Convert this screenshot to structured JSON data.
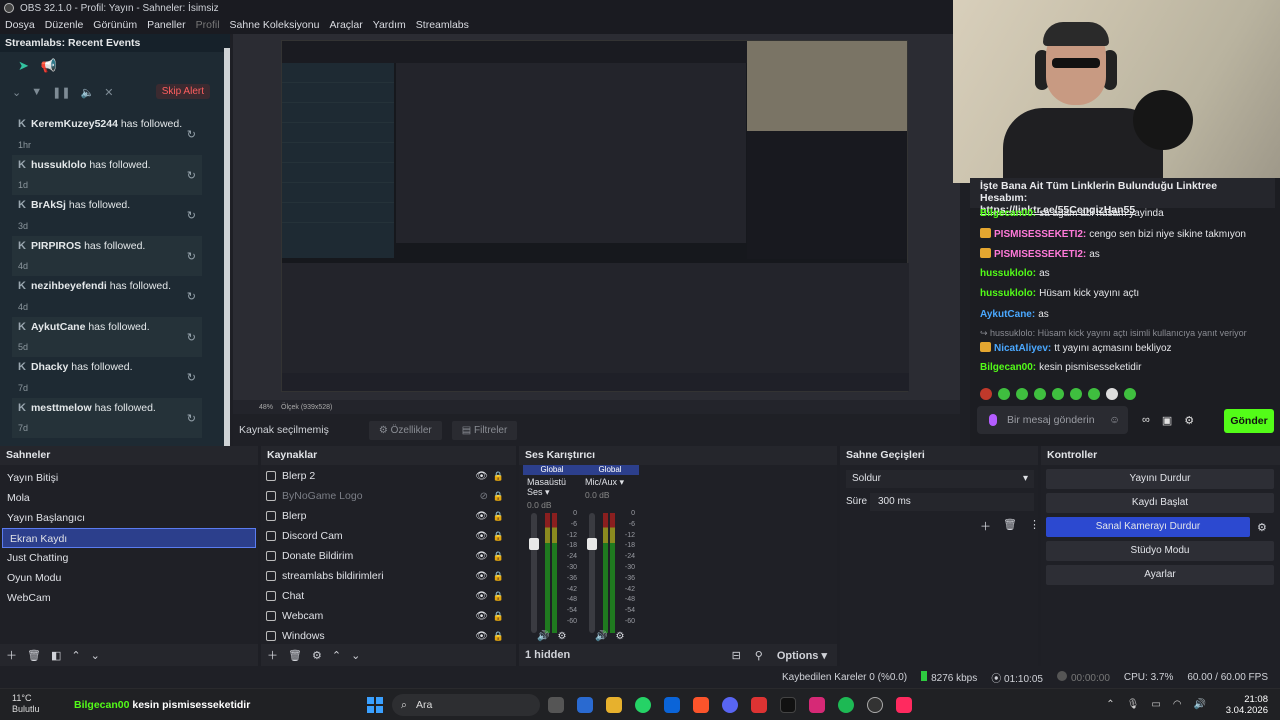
{
  "window": {
    "title": "OBS 32.1.0 - Profil: Yayın - Sahneler: İsimsiz"
  },
  "menu": [
    "Dosya",
    "Düzenle",
    "Görünüm",
    "Paneller",
    "Profil",
    "Sahne Koleksiyonu",
    "Araçlar",
    "Yardım",
    "Streamlabs"
  ],
  "events": {
    "title": "Streamlabs: Recent Events",
    "skip_label": "Skip Alert",
    "items": [
      {
        "name": "KeremKuzey5244",
        "action": "has followed.",
        "when": "1hr"
      },
      {
        "name": "hussuklolo",
        "action": "has followed.",
        "when": "1d"
      },
      {
        "name": "BrAkSj",
        "action": "has followed.",
        "when": "3d"
      },
      {
        "name": "PIRPIROS",
        "action": "has followed.",
        "when": "4d"
      },
      {
        "name": "nezihbeyefendi",
        "action": "has followed.",
        "when": "4d"
      },
      {
        "name": "AykutCane",
        "action": "has followed.",
        "when": "5d"
      },
      {
        "name": "Dhacky",
        "action": "has followed.",
        "when": "7d"
      },
      {
        "name": "mesttmelow",
        "action": "has followed.",
        "when": "7d"
      }
    ]
  },
  "preview": {
    "zoom": "48%",
    "scale_label": "Ölçek (939x528)"
  },
  "source_bar": {
    "label": "Kaynak seçilmemiş",
    "props": "Özellikler",
    "filters": "Filtreler"
  },
  "chat": {
    "pinned_text": "İşte Bana Ait Tüm Linklerin Bulunduğu Linktree Hesabım:",
    "pinned_link": "https://linktr.ee/55CengizHan55",
    "lines": [
      {
        "user": "Bilgecan00:",
        "text": "sa agam abi husam yayinda",
        "color": "#53fc18",
        "badge": false
      },
      {
        "user": "PISMISESSEKETI2:",
        "text": "cengo sen bizi niye sikine takmıyon",
        "color": "#ff7ad9",
        "badge": true
      },
      {
        "user": "PISMISESSEKETI2:",
        "text": "as",
        "color": "#ff7ad9",
        "badge": true
      },
      {
        "user": "hussuklolo:",
        "text": "as",
        "color": "#53fc18",
        "badge": false
      },
      {
        "user": "hussuklolo:",
        "text": "Hüsam kick yayını açtı",
        "color": "#53fc18",
        "badge": false
      },
      {
        "user": "AykutCane:",
        "text": "as",
        "color": "#4aa8ff",
        "badge": false
      },
      {
        "user": "",
        "text": "↪ hussuklolo: Hüsam kick yayını açtı isimli kullanıcıya yanıt veriyor",
        "color": "#8a8c93",
        "badge": false
      },
      {
        "user": "NicatAliyev:",
        "text": "tt yayını açmasını bekliyoz",
        "color": "#4aa8ff",
        "badge": true
      },
      {
        "user": "Bilgecan00:",
        "text": "kesin pismisesseketidir",
        "color": "#53fc18",
        "badge": false
      }
    ],
    "input_placeholder": "Bir mesaj gönderin",
    "send_label": "Gönder"
  },
  "scenes": {
    "title": "Sahneler",
    "items": [
      "Yayın Bitişi",
      "Mola",
      "Yayın Başlangıcı",
      "Ekran Kaydı",
      "Just Chatting",
      "Oyun Modu",
      "WebCam"
    ],
    "selected": 3
  },
  "sources": {
    "title": "Kaynaklar",
    "items": [
      {
        "name": "Blerp 2",
        "dim": false
      },
      {
        "name": "ByNoGame Logo",
        "dim": true
      },
      {
        "name": "Blerp",
        "dim": false
      },
      {
        "name": "Discord Cam",
        "dim": false
      },
      {
        "name": "Donate Bildirim",
        "dim": false
      },
      {
        "name": "streamlabs bildirimleri",
        "dim": false
      },
      {
        "name": "Chat",
        "dim": false
      },
      {
        "name": "Webcam",
        "dim": false
      },
      {
        "name": "Windows",
        "dim": false
      }
    ]
  },
  "mixer": {
    "title": "Ses Karıştırıcı",
    "channels": [
      {
        "tag": "Global",
        "name": "Masaüstü Ses",
        "db": "0.0 dB",
        "level": 0.75
      },
      {
        "tag": "Global",
        "name": "Mic/Aux",
        "db": "0.0 dB",
        "level": 0.75
      }
    ],
    "ticks": [
      "0",
      "-6",
      "-12",
      "-18",
      "-24",
      "-30",
      "-36",
      "-42",
      "-48",
      "-54",
      "-60"
    ],
    "hidden_label": "1 hidden",
    "options_label": "Options"
  },
  "transitions": {
    "title": "Sahne Geçişleri",
    "selected": "Soldur",
    "duration_label": "Süre",
    "duration": "300 ms"
  },
  "controls": {
    "title": "Kontroller",
    "buttons": [
      "Yayını Durdur",
      "Kaydı Başlat",
      "Sanal Kamerayı Durdur",
      "Stüdyo Modu",
      "Ayarlar"
    ],
    "active_index": 2
  },
  "status": {
    "dropped": "Kaybedilen Kareler 0 (%0.0)",
    "bitrate": "8276 kbps",
    "live_time": "01:10:05",
    "rec_time": "00:00:00",
    "cpu": "CPU: 3.7%",
    "fps": "60.00 / 60.00 FPS"
  },
  "taskbar": {
    "temp": "11°C",
    "weather": "Bulutlu",
    "ticker_user": "Bilgecan00",
    "ticker_text": "kesin pismisesseketidir",
    "search": "Ara",
    "time": "21:08",
    "date": "3.04.2026"
  }
}
